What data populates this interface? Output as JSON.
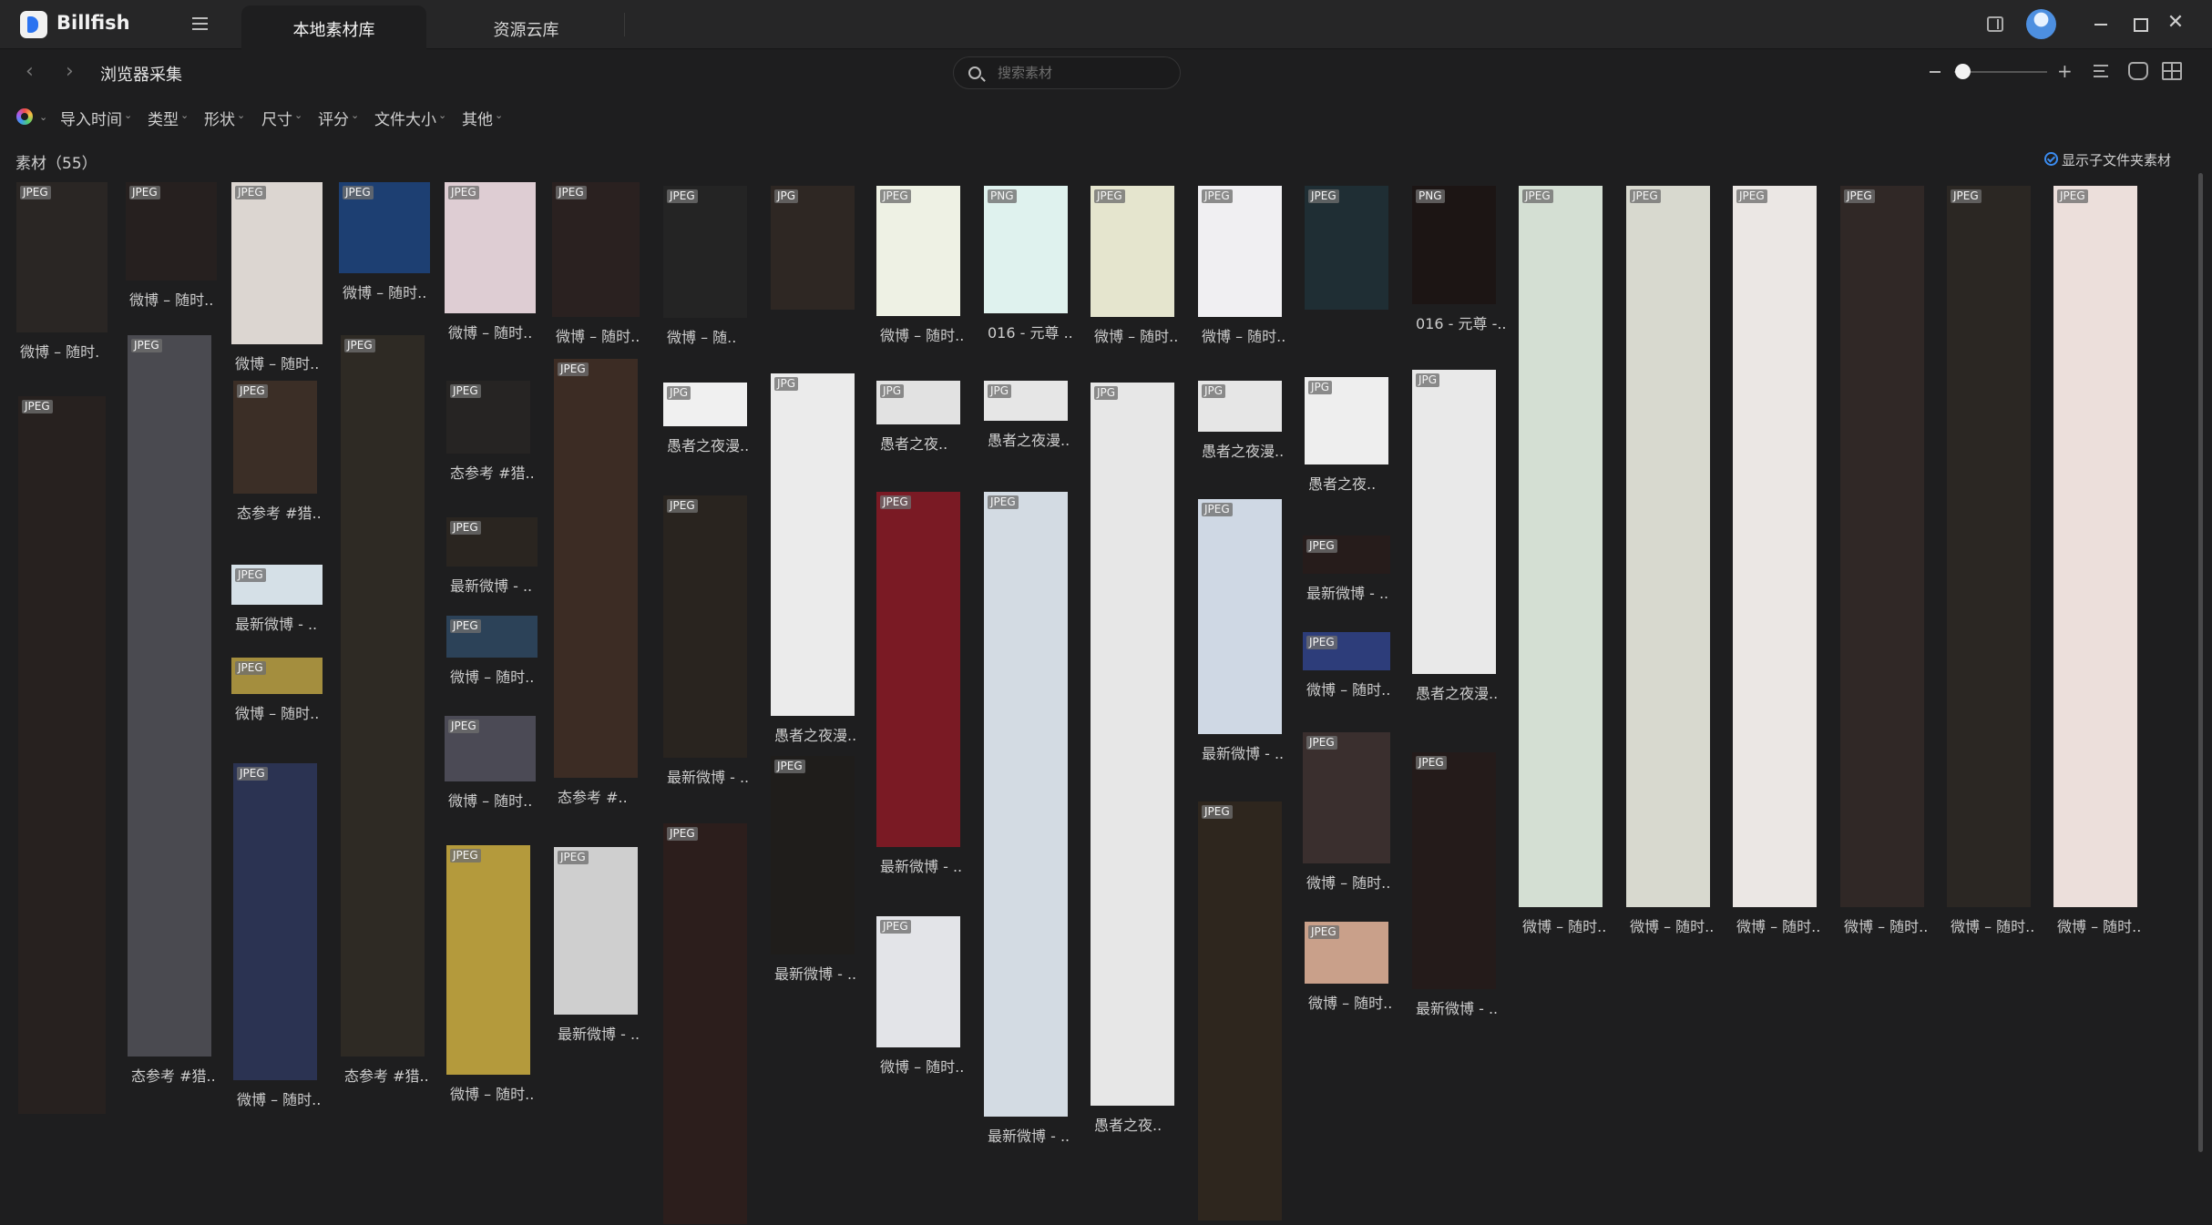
{
  "app": {
    "name": "Billfish"
  },
  "tabs": {
    "local": "本地素材库",
    "cloud": "资源云库"
  },
  "breadcrumb": "浏览器采集",
  "search": {
    "placeholder": "搜索素材"
  },
  "filters": [
    "导入时间",
    "类型",
    "形状",
    "尺寸",
    "评分",
    "文件大小",
    "其他"
  ],
  "count_label": "素材（55）",
  "show_subfolder_label": "显示子文件夹素材",
  "colors": {
    "titlebar": "#262627",
    "background": "#1e1e1f",
    "accent": "#3b8cf0"
  },
  "items": [
    {
      "badge": "JPEG",
      "caption": "微博 – 随时.",
      "color": "#2a2624"
    },
    {
      "badge": "JPEG",
      "caption": "",
      "color": "#27211f"
    },
    {
      "badge": "JPEG",
      "caption": "微博 – 随时..",
      "color": "#26201f"
    },
    {
      "badge": "JPEG",
      "caption": "态参考 #猎..",
      "color": "#4a4a50"
    },
    {
      "badge": "JPEG",
      "caption": "微博 – 随时..",
      "color": "#dcd6d1"
    },
    {
      "badge": "JPEG",
      "caption": "态参考 #猎..",
      "color": "#3b2e26"
    },
    {
      "badge": "JPEG",
      "caption": "最新微博 - ..",
      "color": "#d5e0e7"
    },
    {
      "badge": "JPEG",
      "caption": "微博 – 随时..",
      "color": "#a48e3e"
    },
    {
      "badge": "JPEG",
      "caption": "微博 – 随时..",
      "color": "#2b3352"
    },
    {
      "badge": "JPEG",
      "caption": "微博 – 随时..",
      "color": "#1d3f72"
    },
    {
      "badge": "JPEG",
      "caption": "态参考 #猎..",
      "color": "#2e2a24"
    },
    {
      "badge": "JPEG",
      "caption": "微博 – 随时..",
      "color": "#decdd3"
    },
    {
      "badge": "JPEG",
      "caption": "态参考 #猎..",
      "color": "#262423"
    },
    {
      "badge": "JPEG",
      "caption": "最新微博 - ..",
      "color": "#2a2520"
    },
    {
      "badge": "JPEG",
      "caption": "微博 – 随时..",
      "color": "#2c4258"
    },
    {
      "badge": "JPEG",
      "caption": "微博 – 随时..",
      "color": "#4b4a55"
    },
    {
      "badge": "JPEG",
      "caption": "微博 – 随时..",
      "color": "#b49a3c"
    },
    {
      "badge": "JPEG",
      "caption": "微博 – 随时..",
      "color": "#2a2120"
    },
    {
      "badge": "JPEG",
      "caption": "态参考 #..",
      "color": "#3c2c24"
    },
    {
      "badge": "JPEG",
      "caption": "最新微博 - ..",
      "color": "#cfcfcf"
    },
    {
      "badge": "JPEG",
      "caption": "微博 – 随..",
      "color": "#242424"
    },
    {
      "badge": "JPG",
      "caption": "愚者之夜漫..",
      "color": "#f0f0f0"
    },
    {
      "badge": "JPEG",
      "caption": "最新微博 - ..",
      "color": "#29241f"
    },
    {
      "badge": "JPEG",
      "caption": "微博 – 随时..",
      "color": "#2c1e1c"
    },
    {
      "badge": "JPG",
      "caption": "",
      "color": "#2e2723"
    },
    {
      "badge": "JPG",
      "caption": "愚者之夜漫..",
      "color": "#ebebeb"
    },
    {
      "badge": "JPEG",
      "caption": "最新微博 - ..",
      "color": "#1f1d1b"
    },
    {
      "badge": "JPEG",
      "caption": "微博 – 随时..",
      "color": "#eef1e4"
    },
    {
      "badge": "JPG",
      "caption": "愚者之夜..",
      "color": "#e2e2e2"
    },
    {
      "badge": "JPEG",
      "caption": "最新微博 - ..",
      "color": "#7a1a24"
    },
    {
      "badge": "JPEG",
      "caption": "微博 – 随时..",
      "color": "#e3e4e8"
    },
    {
      "badge": "PNG",
      "caption": "016 - 元尊 ..",
      "color": "#dff2ee"
    },
    {
      "badge": "JPG",
      "caption": "愚者之夜漫..",
      "color": "#e6e6e6"
    },
    {
      "badge": "JPEG",
      "caption": "最新微博 - ..",
      "color": "#d3dbe3"
    },
    {
      "badge": "JPEG",
      "caption": "微博 – 随时..",
      "color": "#e5e5ce"
    },
    {
      "badge": "JPG",
      "caption": "愚者之夜..",
      "color": "#e7e7e7"
    },
    {
      "badge": "JPEG",
      "caption": "微博 – 随时..",
      "color": "#f0eff2"
    },
    {
      "badge": "JPG",
      "caption": "愚者之夜漫..",
      "color": "#e6e6e6"
    },
    {
      "badge": "JPEG",
      "caption": "最新微博 - ..",
      "color": "#cfd8e4"
    },
    {
      "badge": "JPEG",
      "caption": "微博 – 随时..",
      "color": "#2e261e"
    },
    {
      "badge": "JPEG",
      "caption": "",
      "color": "#1f2e34"
    },
    {
      "badge": "JPG",
      "caption": "愚者之夜..",
      "color": "#eeeeee"
    },
    {
      "badge": "JPEG",
      "caption": "最新微博 - ..",
      "color": "#261c1b"
    },
    {
      "badge": "JPEG",
      "caption": "微博 – 随时..",
      "color": "#2d3d7a"
    },
    {
      "badge": "JPEG",
      "caption": "微博 – 随时..",
      "color": "#3a2f2e"
    },
    {
      "badge": "JPEG",
      "caption": "微博 – 随时..",
      "color": "#c9a08a"
    },
    {
      "badge": "PNG",
      "caption": "016 - 元尊 -..",
      "color": "#1c1514"
    },
    {
      "badge": "JPG",
      "caption": "愚者之夜漫..",
      "color": "#e9e9e9"
    },
    {
      "badge": "JPEG",
      "caption": "最新微博 - ..",
      "color": "#241b1a"
    },
    {
      "badge": "JPEG",
      "caption": "微博 – 随时..",
      "color": "#d4dfd3"
    },
    {
      "badge": "JPEG",
      "caption": "微博 – 随时..",
      "color": "#d8d9cf"
    },
    {
      "badge": "JPEG",
      "caption": "微博 – 随时..",
      "color": "#ebe7e4"
    },
    {
      "badge": "JPEG",
      "caption": "微博 – 随时..",
      "color": "#302826"
    },
    {
      "badge": "JPEG",
      "caption": "微博 – 随时..",
      "color": "#2b2723"
    },
    {
      "badge": "JPEG",
      "caption": "微博 – 随时..",
      "color": "#ecdfdb"
    },
    {
      "badge": "JPEG",
      "caption": "微博 – 随时..",
      "color": "#dedad9"
    }
  ]
}
